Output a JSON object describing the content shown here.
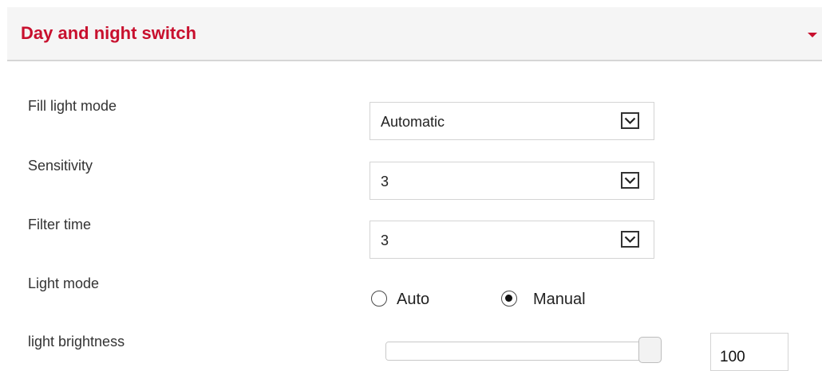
{
  "theme": {
    "accent_color": "#c8102e"
  },
  "panel": {
    "title": "Day and night switch",
    "collapse_icon": "caret-down-icon"
  },
  "fields": {
    "fill_light_mode": {
      "label": "Fill light mode",
      "value": "Automatic"
    },
    "sensitivity": {
      "label": "Sensitivity",
      "value": "3"
    },
    "filter_time": {
      "label": "Filter time",
      "value": "3"
    },
    "light_mode": {
      "label": "Light mode",
      "options": [
        "Auto",
        "Manual"
      ],
      "selected": "Manual"
    },
    "light_brightness": {
      "label": "light brightness",
      "value": "100",
      "min": 0,
      "max": 100
    }
  },
  "icons": {
    "dropdown": "chevron-down-icon",
    "radio": "radio-button-icon"
  }
}
